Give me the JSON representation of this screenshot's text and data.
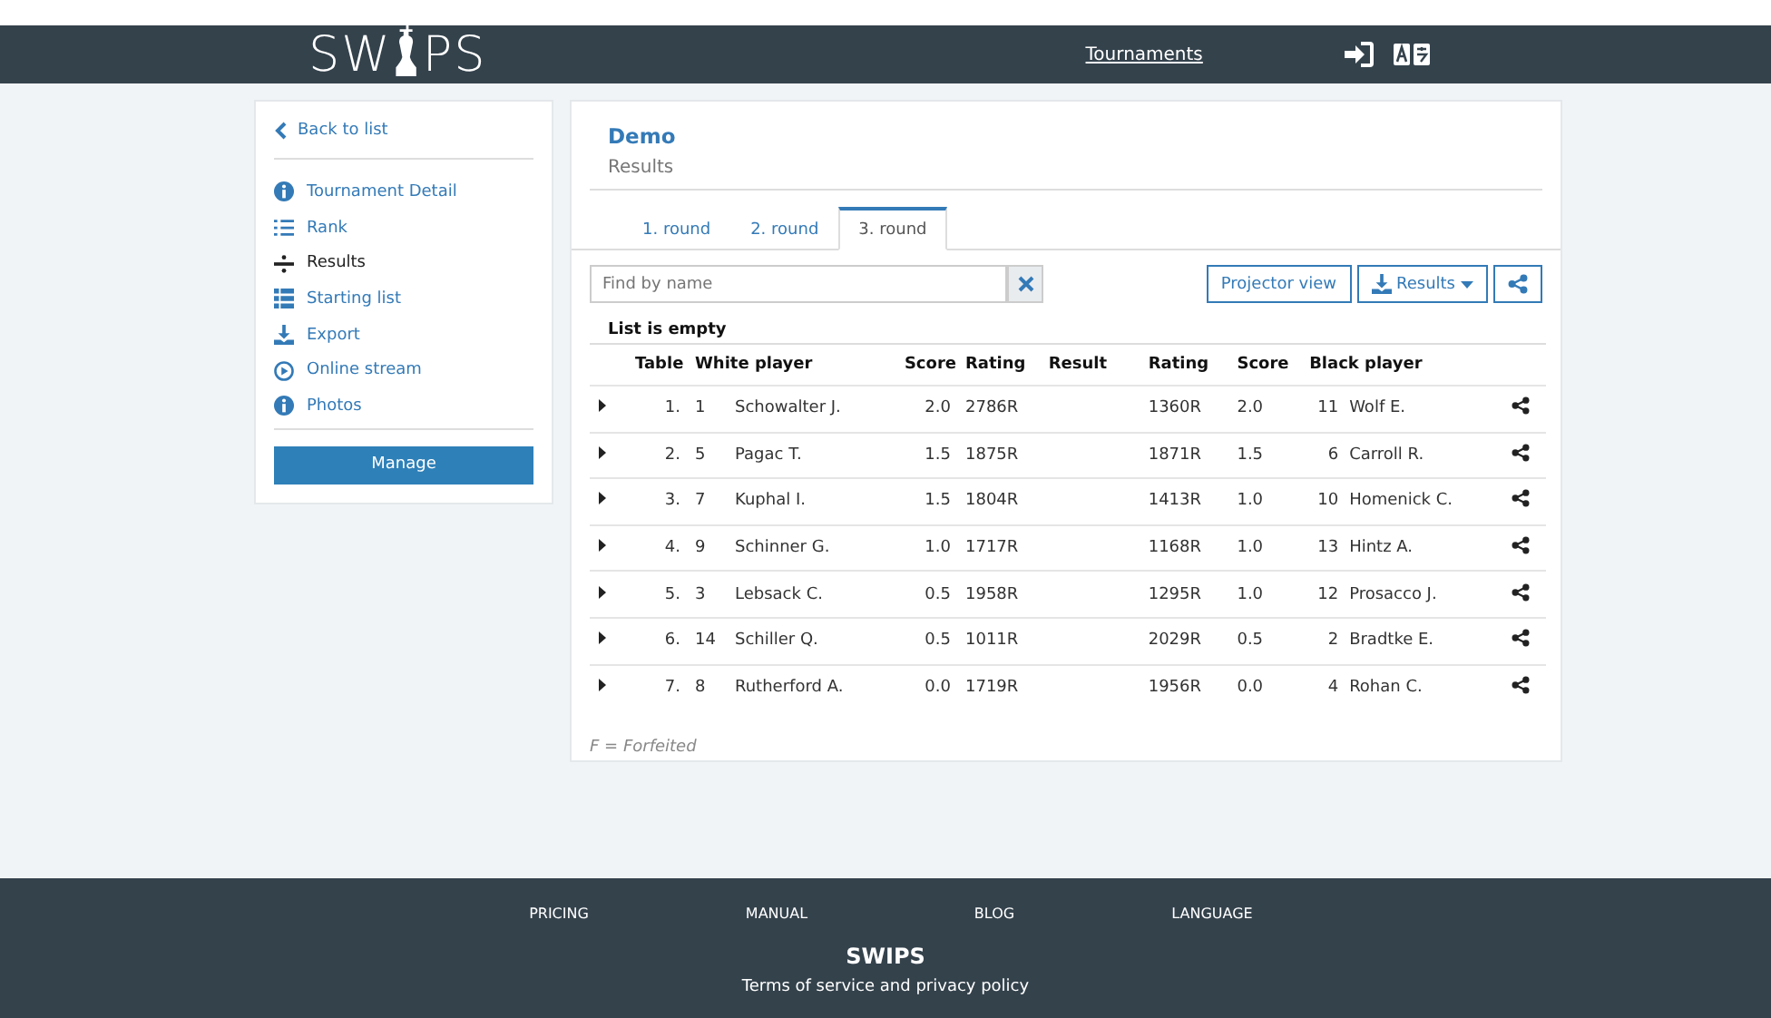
{
  "header": {
    "logo_left": "SW",
    "logo_right": "PS",
    "nav_link": "Tournaments"
  },
  "sidebar": {
    "back": "Back to list",
    "items": [
      {
        "label": "Tournament Detail",
        "selected": false
      },
      {
        "label": "Rank",
        "selected": false
      },
      {
        "label": "Results",
        "selected": true
      },
      {
        "label": "Starting list",
        "selected": false
      },
      {
        "label": "Export",
        "selected": false
      },
      {
        "label": "Online stream",
        "selected": false
      },
      {
        "label": "Photos",
        "selected": false
      }
    ],
    "button": "Manage"
  },
  "main": {
    "title": "Demo",
    "subtitle": "Results",
    "tabs": [
      {
        "label": "1. round",
        "selected": false
      },
      {
        "label": "2. round",
        "selected": false
      },
      {
        "label": "3. round",
        "selected": true
      }
    ],
    "search": {
      "placeholder": "Find by name"
    },
    "buttons": {
      "projector": "Projector view",
      "results": "Results"
    },
    "empty_note": "List is empty",
    "table": {
      "columns": [
        "Table",
        "White player",
        "Score",
        "Rating",
        "Result",
        "Rating",
        "Score",
        "Black player"
      ],
      "rows": [
        {
          "table": "1.",
          "white_no": "1",
          "white": "Schowalter J.",
          "white_score": "2.0",
          "white_rating": "2786R",
          "black_rating": "1360R",
          "black_score": "2.0",
          "black_no": "11",
          "black": "Wolf E."
        },
        {
          "table": "2.",
          "white_no": "5",
          "white": "Pagac T.",
          "white_score": "1.5",
          "white_rating": "1875R",
          "black_rating": "1871R",
          "black_score": "1.5",
          "black_no": "6",
          "black": "Carroll R."
        },
        {
          "table": "3.",
          "white_no": "7",
          "white": "Kuphal I.",
          "white_score": "1.5",
          "white_rating": "1804R",
          "black_rating": "1413R",
          "black_score": "1.0",
          "black_no": "10",
          "black": "Homenick C."
        },
        {
          "table": "4.",
          "white_no": "9",
          "white": "Schinner G.",
          "white_score": "1.0",
          "white_rating": "1717R",
          "black_rating": "1168R",
          "black_score": "1.0",
          "black_no": "13",
          "black": "Hintz A."
        },
        {
          "table": "5.",
          "white_no": "3",
          "white": "Lebsack C.",
          "white_score": "0.5",
          "white_rating": "1958R",
          "black_rating": "1295R",
          "black_score": "1.0",
          "black_no": "12",
          "black": "Prosacco J."
        },
        {
          "table": "6.",
          "white_no": "14",
          "white": "Schiller Q.",
          "white_score": "0.5",
          "white_rating": "1011R",
          "black_rating": "2029R",
          "black_score": "0.5",
          "black_no": "2",
          "black": "Bradtke E."
        },
        {
          "table": "7.",
          "white_no": "8",
          "white": "Rutherford A.",
          "white_score": "0.0",
          "white_rating": "1719R",
          "black_rating": "1956R",
          "black_score": "0.0",
          "black_no": "4",
          "black": "Rohan C."
        }
      ]
    },
    "legend": "F = Forfeited"
  },
  "footer": {
    "links": [
      "PRICING",
      "MANUAL",
      "BLOG",
      "LANGUAGE"
    ],
    "brand": "SWIPS",
    "terms": "Terms of service and privacy policy"
  }
}
